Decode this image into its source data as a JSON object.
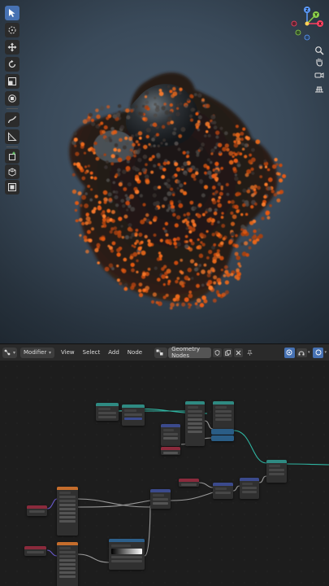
{
  "editor_header": {
    "editor_type_icon": "node-editor-icon",
    "mode_label": "Modifier",
    "menus": [
      "View",
      "Select",
      "Add",
      "Node"
    ],
    "node_tree_name": "Geometry Nodes"
  },
  "viewport": {
    "tools": [
      "select-box-icon",
      "cursor-icon",
      "move-icon",
      "rotate-icon",
      "scale-icon",
      "transform-icon",
      "annotate-icon",
      "measure-icon",
      "add-cube-icon",
      "extrude-icon",
      "inset-icon"
    ],
    "nav": [
      "zoom-icon",
      "pan-hand-icon",
      "camera-icon",
      "grid-view-icon"
    ],
    "gizmo_axes": [
      "X",
      "Y",
      "Z"
    ]
  },
  "colors": {
    "node_geometry": "#2f8a82",
    "node_input": "#8a2a3c",
    "node_utility": "#3b4a8c",
    "node_texture": "#c56d2c",
    "node_color": "#2d5f8a",
    "link_geometry": "#2fb5a2",
    "link_float": "#9a9a9a",
    "link_vector": "#6a5acd",
    "accent": "#4772b3",
    "orange_particle": "#f06a1a"
  }
}
